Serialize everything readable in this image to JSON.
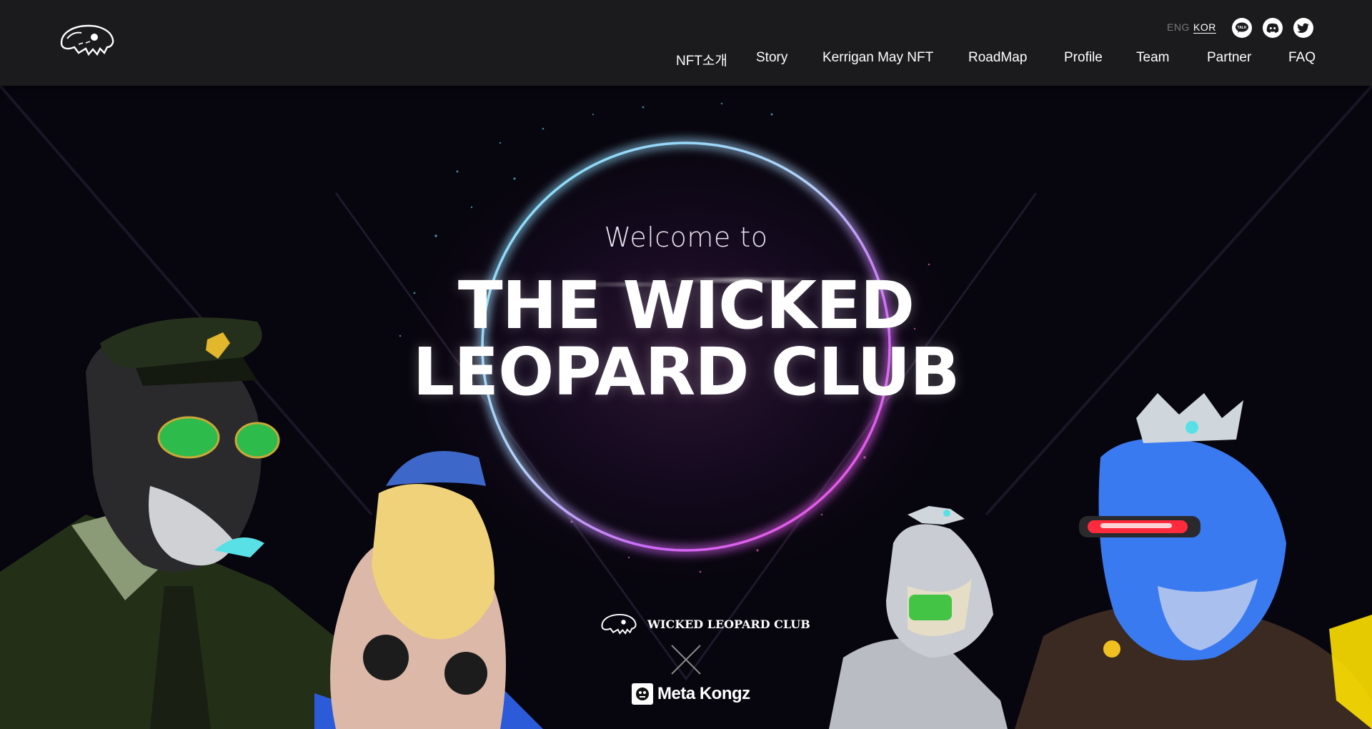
{
  "header": {
    "lang": {
      "eng": "ENG",
      "kor": "KOR"
    },
    "nav": [
      "NFT소개",
      "Story",
      "Kerrigan May NFT",
      "RoadMap",
      "Profile",
      "Team",
      "Partner",
      "FAQ"
    ]
  },
  "social_icons": [
    "kakaotalk-icon",
    "discord-icon",
    "twitter-icon"
  ],
  "hero": {
    "welcome": "Welcome to",
    "title_line1": "THE WICKED",
    "title_line2": "LEOPARD CLUB",
    "collab_brand1": "WICKED LEOPARD CLUB",
    "collab_brand2": "Meta Kongz"
  },
  "colors": {
    "header_bg": "#1b1a1d",
    "hero_bg": "#07050d",
    "ring_cyan": "#7fe6ff",
    "ring_magenta": "#ff4fe0",
    "text": "#ffffff"
  }
}
